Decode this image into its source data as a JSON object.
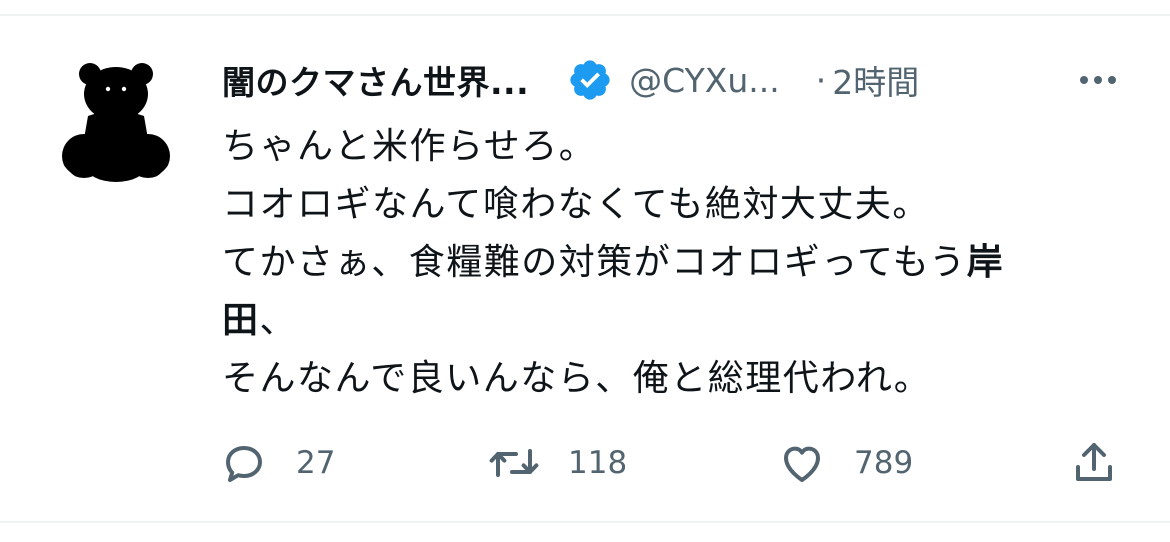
{
  "tweet": {
    "display_name": "闇のクマさん世界...",
    "handle": "@CYXu...",
    "separator": "·",
    "time": "2時間",
    "text_lines": [
      "ちゃんと米作らせろ。",
      "コオロギなんて喰わなくても絶対大丈夫。",
      "てかさぁ、食糧難の対策がコオロギってもう",
      "岸",
      "田",
      "、",
      "そんなんで良いんなら、俺と総理代われ。"
    ],
    "actions": {
      "replies": "27",
      "retweets": "118",
      "likes": "789"
    },
    "icons": {
      "avatar": "black-bear-silhouette",
      "verified": "verified-badge-icon",
      "more": "more-dots-icon",
      "reply": "reply-icon",
      "retweet": "retweet-icon",
      "like": "heart-icon",
      "share": "share-icon"
    },
    "colors": {
      "verified": "#1d9bf0",
      "text": "#0f1419",
      "secondary": "#536471",
      "divider": "#eff3f4"
    }
  }
}
